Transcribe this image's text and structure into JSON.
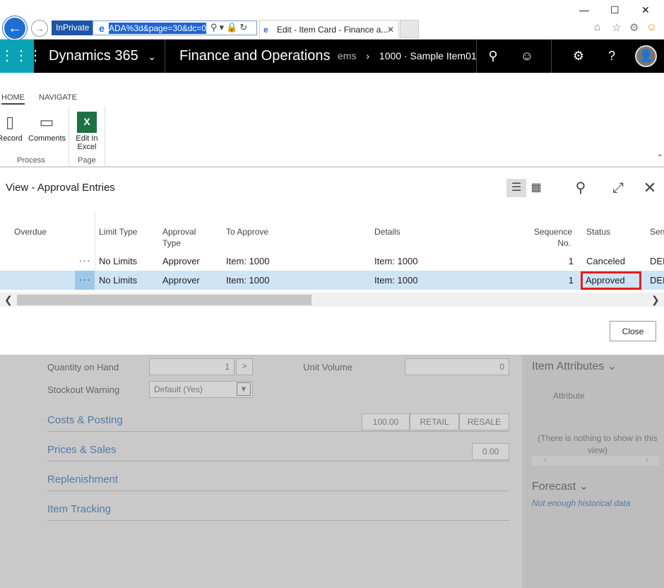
{
  "browser": {
    "inprivate_label": "InPrivate",
    "url": "ADA%3d&page=30&dc=0",
    "tab_title": "Edit - Item Card - Finance a...",
    "tab_close": "✕"
  },
  "nav": {
    "brand": "Dynamics 365",
    "module": "Finance and Operations",
    "breadcrumb_prefix": "ems",
    "breadcrumb_current": "1000 · Sample Item01"
  },
  "ribbon": {
    "tabs": [
      "HOME",
      "NAVIGATE"
    ],
    "buttons": {
      "record": "Record",
      "comments": "Comments",
      "edit_excel_line1": "Edit In",
      "edit_excel_line2": "Excel"
    },
    "groups": {
      "process": "Process",
      "page": "Page"
    }
  },
  "dialog": {
    "title": "View - Approval Entries",
    "columns": {
      "overdue": "Overdue",
      "limit_type": "Limit Type",
      "approval_type_1": "Approval",
      "approval_type_2": "Type",
      "to_approve": "To Approve",
      "details": "Details",
      "sequence_1": "Sequence",
      "sequence_2": "No.",
      "status": "Status",
      "sender_partial": "Sen"
    },
    "rows": [
      {
        "dots": "···",
        "limit_type": "No Limits",
        "approval_type": "Approver",
        "to_approve": "Item: 1000",
        "details": "Item: 1000",
        "sequence": "1",
        "status": "Canceled",
        "sender_partial": "DEI"
      },
      {
        "dots": "···",
        "limit_type": "No Limits",
        "approval_type": "Approver",
        "to_approve": "Item: 1000",
        "details": "Item: 1000",
        "sequence": "1",
        "status": "Approved",
        "sender_partial": "DEI"
      }
    ],
    "close_button": "Close"
  },
  "background_form": {
    "quantity_on_hand_label": "Quantity on Hand",
    "quantity_on_hand_value": "1",
    "unit_volume_label": "Unit Volume",
    "unit_volume_value": "0",
    "stockout_label": "Stockout Warning",
    "stockout_value": "Default (Yes)",
    "costs_posting": "Costs & Posting",
    "costs_values": [
      "100.00",
      "RETAIL",
      "RESALE"
    ],
    "prices_sales": "Prices & Sales",
    "prices_value": "0.00",
    "replenishment": "Replenishment",
    "item_tracking": "Item Tracking",
    "item_attributes": "Item Attributes",
    "attribute_header": "Attribute",
    "nothing_to_show": "(There is nothing to show in this view)",
    "forecast": "Forecast",
    "forecast_note": "Not enough historical data"
  },
  "colors": {
    "accent_teal": "#0aa3b3",
    "nav_black": "#000000",
    "selected_row": "#cfe4f5",
    "highlight_red": "#e0201e"
  }
}
